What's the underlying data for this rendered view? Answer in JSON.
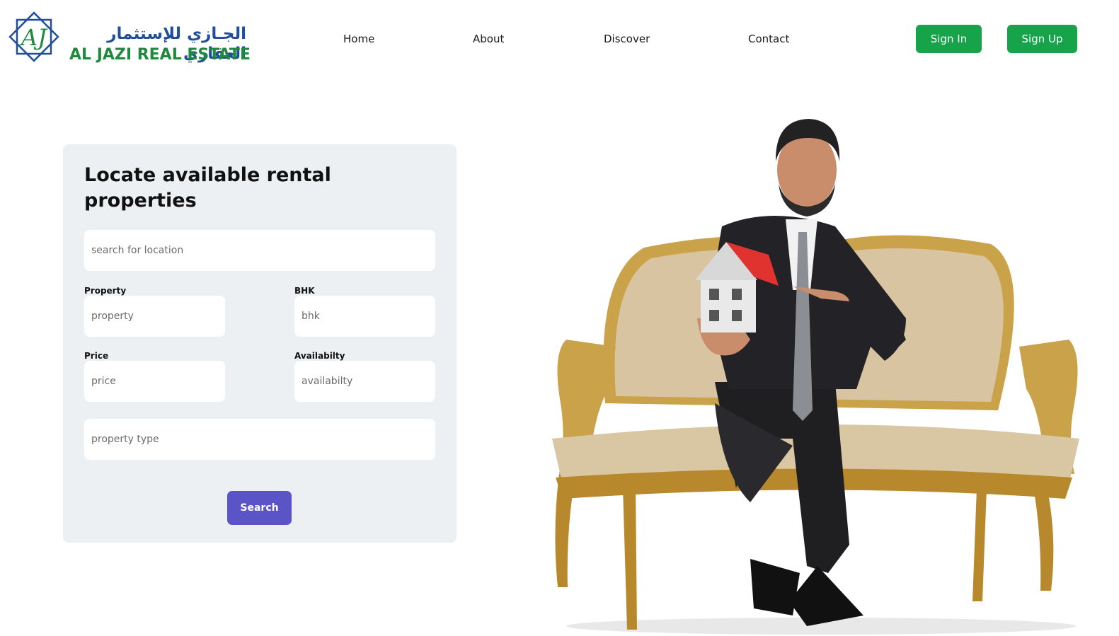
{
  "brand": {
    "arabic_name": "الجـازي للإستثمار العقاري",
    "english_name": "AL JAZI REAL ESTATE",
    "monogram": "AJ",
    "colors": {
      "blue": "#1f4f9c",
      "green": "#1f8a3d"
    }
  },
  "nav": {
    "items": [
      {
        "label": "Home"
      },
      {
        "label": "About"
      },
      {
        "label": "Discover"
      },
      {
        "label": "Contact"
      }
    ],
    "sign_in_label": "Sign In",
    "sign_up_label": "Sign Up",
    "button_color": "#17a34a"
  },
  "search_card": {
    "title": "Locate available rental properties",
    "location_placeholder": "search for location",
    "property": {
      "label": "Property",
      "placeholder": "property"
    },
    "bhk": {
      "label": "BHK",
      "placeholder": "bhk"
    },
    "price": {
      "label": "Price",
      "placeholder": "price"
    },
    "availability": {
      "label": "Availabilty",
      "placeholder": "availabilty"
    },
    "property_type_placeholder": "property type",
    "search_label": "Search",
    "search_color": "#5b54c6"
  },
  "hero": {
    "icon": "businessman-on-sofa-with-house-image"
  }
}
